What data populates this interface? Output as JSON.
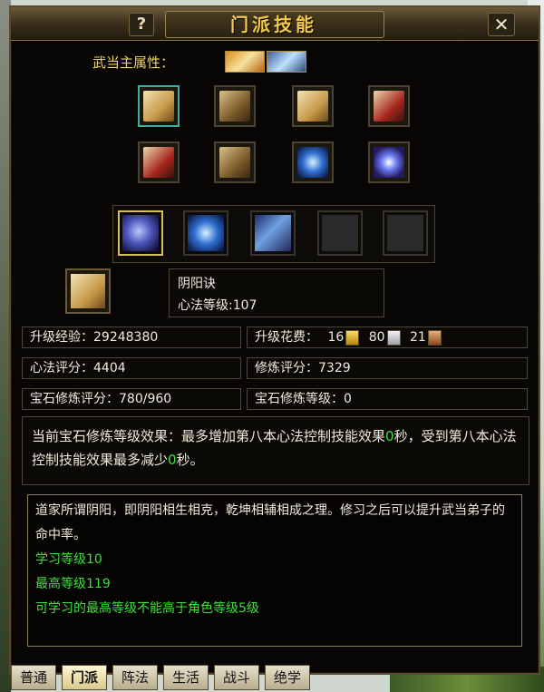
{
  "window": {
    "title": "门派技能",
    "help_label": "?",
    "close_label": "✕"
  },
  "attribute": {
    "label": "武当主属性：",
    "icons": [
      "fire-attr-icon",
      "water-attr-icon"
    ]
  },
  "skill_rows": [
    [
      "scroll-icon",
      "book-icon",
      "parchment-icon",
      "red-book-icon"
    ],
    [
      "blue-book-icon",
      "scroll-bundle-icon",
      "blue-tome-icon",
      "galaxy-icon"
    ]
  ],
  "slots": [
    "palm-icon",
    "blue-swirl-icon",
    "face-moon-icon",
    "empty-slot",
    "empty-slot"
  ],
  "selected": {
    "name": "阴阳诀",
    "level_text": "心法等级:107"
  },
  "stats": {
    "upgrade_exp": "升级经验：29248380",
    "upgrade_cost_label": "升级花费：",
    "cost_gold": "16",
    "cost_silver": "80",
    "cost_bronze": "21",
    "xinfa_score": "心法评分：4404",
    "xiulian_score": "修炼评分：7329",
    "gem_score": "宝石修炼评分：780/960",
    "gem_level": "宝石修炼等级：0"
  },
  "effect": {
    "part1": "当前宝石修炼等级效果：最多增加第八本心法控制技能效果",
    "value1": "0",
    "part2": "秒，受到第八本心法控制技能效果最多减少",
    "value2": "0",
    "part3": "秒。"
  },
  "description": {
    "text": "道家所谓阴阳，即阴阳相生相克，乾坤相辅相成之理。修习之后可以提升武当弟子的命中率。",
    "learn_level": "学习等级10",
    "max_level": "最高等级119",
    "note": "可学习的最高等级不能高于角色等级5级"
  },
  "tabs": [
    "普通",
    "门派",
    "阵法",
    "生活",
    "战斗",
    "绝学"
  ],
  "active_tab": "门派"
}
